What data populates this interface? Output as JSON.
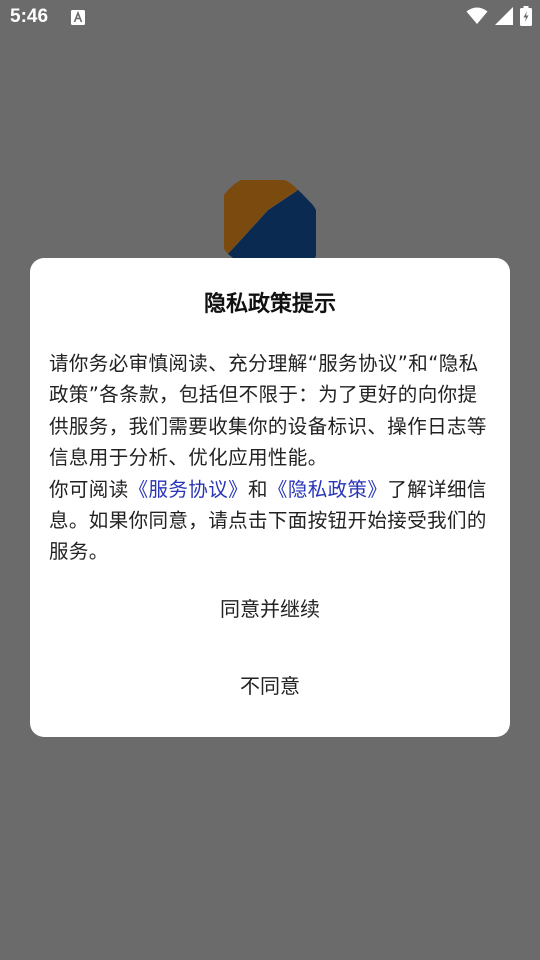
{
  "status_bar": {
    "time": "5:46",
    "notification_icon": "font-a-icon",
    "wifi_icon": "wifi-icon",
    "signal_icon": "cell-signal-icon",
    "battery_icon": "battery-charging-icon"
  },
  "app": {
    "logo_icon": "app-logo",
    "logo_colors": {
      "orange": "#7a4a0e",
      "navy": "#0a2a52",
      "light": "#dfe3ea"
    }
  },
  "dialog": {
    "title": "隐私政策提示",
    "paragraph1": "请你务必审慎阅读、充分理解“服务协议”和“隐私政策”各条款，包括但不限于：为了更好的向你提供服务，我们需要收集你的设备标识、操作日志等信息用于分析、优化应用性能。",
    "paragraph2_prefix": "你可阅读",
    "service_link": "《服务协议》",
    "paragraph2_and": "和",
    "privacy_link": "《隐私政策》",
    "paragraph2_suffix": "了解详细信息。如果你同意，请点击下面按钮开始接受我们的服务。",
    "agree_label": "同意并继续",
    "disagree_label": "不同意",
    "link_color": "#2834b8"
  }
}
